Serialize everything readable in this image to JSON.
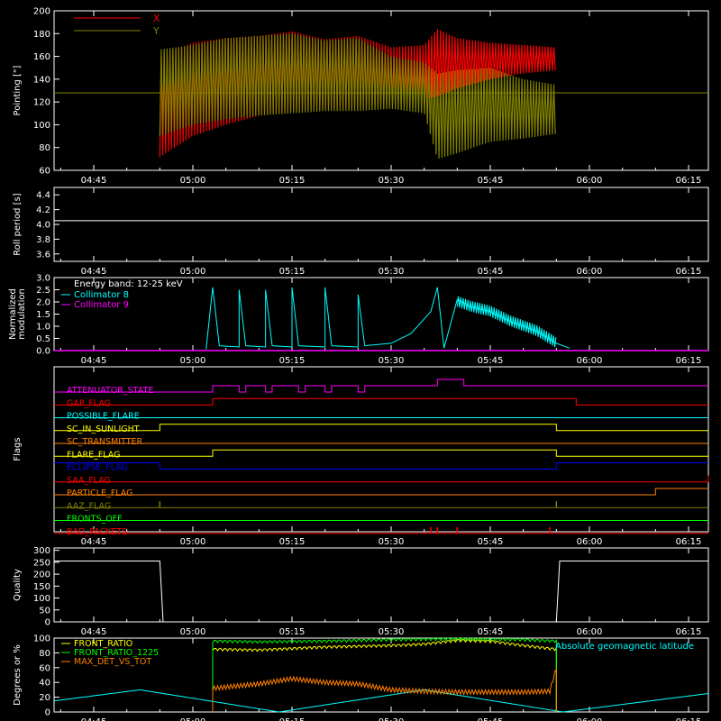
{
  "figure": {
    "background": "#000000",
    "axis_color": "#ffffff",
    "x_ticks": [
      "04:45",
      "05:00",
      "05:15",
      "05:30",
      "05:45",
      "06:00",
      "06:15"
    ]
  },
  "chart_data": [
    {
      "id": "pointing",
      "type": "line",
      "ylabel": "Pointing [\"]",
      "ylim": [
        60,
        200
      ],
      "yticks": [
        60,
        80,
        100,
        120,
        140,
        160,
        180,
        200
      ],
      "xlim": [
        "04:39",
        "06:18"
      ],
      "legend": "top-left",
      "reference_line": {
        "y": 128,
        "color": "#808000"
      },
      "data_window": [
        "04:55",
        "05:55"
      ],
      "series": [
        {
          "name": "X",
          "color": "#ff0000",
          "x": [
            "04:55",
            "05:00",
            "05:05",
            "05:10",
            "05:15",
            "05:20",
            "05:25",
            "05:30",
            "05:35",
            "05:37",
            "05:40",
            "05:45",
            "05:50",
            "05:55"
          ],
          "upper": [
            160,
            172,
            176,
            178,
            182,
            175,
            178,
            168,
            170,
            184,
            176,
            172,
            170,
            168
          ],
          "lower": [
            72,
            90,
            100,
            108,
            112,
            114,
            115,
            118,
            122,
            125,
            132,
            140,
            145,
            148
          ]
        },
        {
          "name": "Y",
          "color": "#808000",
          "x": [
            "04:55",
            "05:00",
            "05:05",
            "05:10",
            "05:15",
            "05:20",
            "05:25",
            "05:30",
            "05:35",
            "05:37",
            "05:40",
            "05:45",
            "05:50",
            "05:55"
          ],
          "upper": [
            166,
            170,
            176,
            178,
            180,
            174,
            176,
            160,
            155,
            145,
            148,
            150,
            140,
            135
          ],
          "lower": [
            90,
            100,
            105,
            108,
            110,
            112,
            112,
            114,
            110,
            70,
            75,
            85,
            88,
            92
          ]
        }
      ]
    },
    {
      "id": "roll",
      "type": "line",
      "ylabel": "Roll period [s]",
      "ylim": [
        3.5,
        4.5
      ],
      "yticks": [
        3.6,
        3.8,
        4.0,
        4.2,
        4.4
      ],
      "series": [
        {
          "name": "",
          "color": "#ffffff",
          "x": [
            "04:39",
            "06:18"
          ],
          "values": [
            4.05,
            4.05
          ]
        }
      ]
    },
    {
      "id": "modulation",
      "type": "line",
      "ylabel": [
        "Normalized",
        "modulation"
      ],
      "ylim": [
        0,
        3.0
      ],
      "yticks": [
        0.0,
        0.5,
        1.0,
        1.5,
        2.0,
        2.5,
        3.0
      ],
      "legend": "top-left",
      "legend_title": "Energy band: 12-25 keV",
      "series": [
        {
          "name": "Collimator 8",
          "color": "#00ffff",
          "x": [
            "05:03",
            "05:04",
            "05:07",
            "05:08",
            "05:11",
            "05:12",
            "05:15",
            "05:16",
            "05:20",
            "05:21",
            "05:25",
            "05:26",
            "05:30",
            "05:33",
            "05:36",
            "05:37",
            "05:38",
            "05:40",
            "05:42",
            "05:45",
            "05:48",
            "05:52",
            "05:55",
            "05:57"
          ],
          "values": [
            2.6,
            0.2,
            2.5,
            0.2,
            2.5,
            0.2,
            2.6,
            0.2,
            2.6,
            0.2,
            2.3,
            0.2,
            0.3,
            0.7,
            1.6,
            2.6,
            0.1,
            2.1,
            1.8,
            1.6,
            1.2,
            0.8,
            0.3,
            0.1
          ]
        },
        {
          "name": "Collimator 9",
          "color": "#ff00ff",
          "x": [
            "04:39",
            "06:18"
          ],
          "values": [
            0,
            0
          ]
        }
      ]
    },
    {
      "id": "flags",
      "type": "line",
      "ylabel": "Flags",
      "series": [
        {
          "name": "ATTENUATOR_STATE",
          "color": "#ff00ff",
          "x": [
            "05:03",
            "05:07",
            "05:08",
            "05:11",
            "05:12",
            "05:16",
            "05:17",
            "05:20",
            "05:21",
            "05:25",
            "05:26",
            "05:37",
            "05:41",
            "05:43"
          ],
          "values": [
            1,
            0,
            1,
            0,
            1,
            0,
            1,
            0,
            1,
            0,
            1,
            2,
            1,
            1
          ]
        },
        {
          "name": "GAP_FLAG",
          "color": "#ff0000",
          "x": [
            "05:03",
            "05:58"
          ],
          "values": [
            1,
            0
          ]
        },
        {
          "name": "POSSIBLE_FLARE",
          "color": "#00ffff",
          "x": [],
          "values": []
        },
        {
          "name": "SC_IN_SUNLIGHT",
          "color": "#ffff00",
          "x": [
            "04:55",
            "05:55"
          ],
          "values": [
            1,
            0
          ]
        },
        {
          "name": "SC_TRANSMITTER",
          "color": "#ff8000",
          "x": [],
          "values": []
        },
        {
          "name": "FLARE_FLAG",
          "color": "#ffff00",
          "x": [
            "05:03",
            "05:55"
          ],
          "values": [
            1,
            0
          ]
        },
        {
          "name": "ECLIPSE_FLAG",
          "color": "#0000ff",
          "x": [
            "04:55",
            "05:55"
          ],
          "values": [
            0,
            1
          ]
        },
        {
          "name": "SAA_FLAG",
          "color": "#ff0000",
          "x": [
            "05:01",
            "06:18"
          ],
          "values": [
            0,
            1
          ]
        },
        {
          "name": "PARTICLE_FLAG",
          "color": "#ff8000",
          "x": [
            "05:58",
            "06:10"
          ],
          "values": [
            0,
            1
          ]
        },
        {
          "name": "AAZ_FLAG",
          "color": "#808000",
          "x": [
            "04:55",
            "05:55"
          ],
          "values": [
            1,
            1
          ]
        },
        {
          "name": "FRONTS_OFF",
          "color": "#00ff00",
          "x": [],
          "values": []
        },
        {
          "name": "BAD_PACKETS",
          "color": "#ff0000",
          "x": [
            "05:36",
            "05:37",
            "05:40",
            "05:54"
          ],
          "values": [
            1,
            1,
            1,
            1
          ]
        }
      ]
    },
    {
      "id": "quality",
      "type": "line",
      "ylabel": "Quality",
      "ylim": [
        0,
        310
      ],
      "yticks": [
        0,
        50,
        100,
        150,
        200,
        250,
        300
      ],
      "series": [
        {
          "name": "",
          "color": "#ffffff",
          "x": [
            "04:39",
            "04:55",
            "04:55.5",
            "05:55",
            "05:55.5",
            "06:18"
          ],
          "values": [
            255,
            255,
            0,
            0,
            255,
            255
          ]
        }
      ]
    },
    {
      "id": "geomag",
      "type": "line",
      "ylabel": "Degrees or %",
      "ylim": [
        0,
        100
      ],
      "yticks": [
        0,
        20,
        40,
        60,
        80,
        100
      ],
      "annotation": "Absolute geomagnetic latitude",
      "series": [
        {
          "name": "FRONT_RATIO",
          "color": "#ffff00",
          "x": [
            "05:03",
            "05:10",
            "05:20",
            "05:30",
            "05:35",
            "05:40",
            "05:45",
            "05:50",
            "05:55"
          ],
          "values": [
            85,
            84,
            88,
            90,
            92,
            97,
            96,
            90,
            85
          ]
        },
        {
          "name": "FRONT_RATIO_1225",
          "color": "#00ff00",
          "x": [
            "05:03",
            "05:10",
            "05:20",
            "05:30",
            "05:40",
            "05:50",
            "05:55"
          ],
          "values": [
            96,
            95,
            96,
            98,
            99,
            98,
            96
          ]
        },
        {
          "name": "MAX_DET_VS_TOT",
          "color": "#ff8000",
          "x": [
            "05:03",
            "05:10",
            "05:15",
            "05:20",
            "05:25",
            "05:30",
            "05:35",
            "05:40",
            "05:50",
            "05:54",
            "05:55"
          ],
          "values": [
            32,
            38,
            45,
            40,
            38,
            30,
            28,
            27,
            27,
            28,
            60
          ]
        },
        {
          "name": "",
          "color": "#00ffff",
          "x": [
            "04:39",
            "04:52",
            "05:13",
            "05:35",
            "05:56",
            "06:18"
          ],
          "values": [
            15,
            30,
            0,
            30,
            0,
            25
          ]
        }
      ]
    }
  ]
}
